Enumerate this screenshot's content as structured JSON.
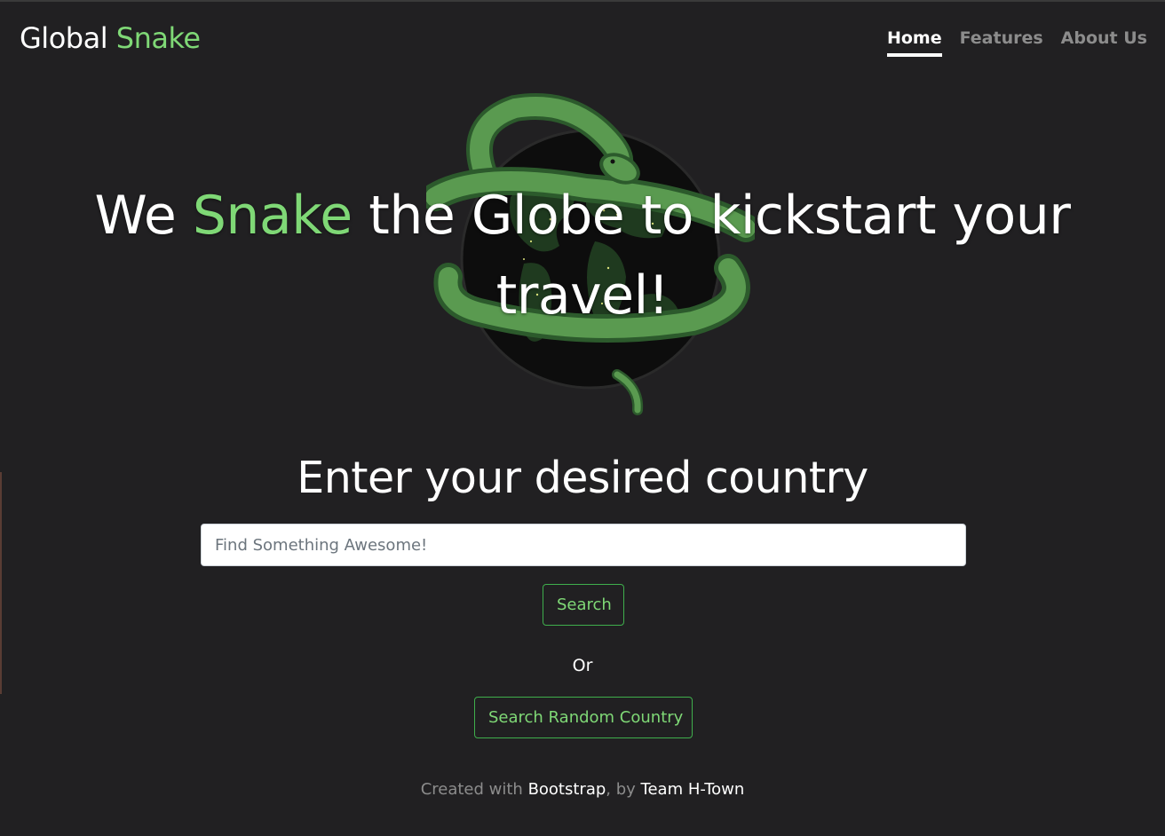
{
  "brand": {
    "name_prefix": "Global ",
    "name_accent": "Snake"
  },
  "nav": {
    "items": [
      {
        "label": "Home",
        "active": true
      },
      {
        "label": "Features",
        "active": false
      },
      {
        "label": "About Us",
        "active": false
      }
    ]
  },
  "hero": {
    "title_before": "We ",
    "title_accent": "Snake",
    "title_after_line1": " the Globe to kickstart your",
    "title_line2": "travel!"
  },
  "search": {
    "heading": "Enter your desired country",
    "placeholder": "Find Something Awesome!",
    "value": "",
    "button_label": "Search",
    "or_label": "Or",
    "random_button_label": "Search Random Country"
  },
  "footer": {
    "prefix": "Created with ",
    "tool": "Bootstrap",
    "middle": ", by ",
    "team": "Team H-Town"
  },
  "colors": {
    "background": "#212022",
    "accent": "#7fd876",
    "button_border": "#3fae4c",
    "muted": "#8c8c8c"
  },
  "icons": {
    "hero_image": "snake-globe-illustration"
  }
}
